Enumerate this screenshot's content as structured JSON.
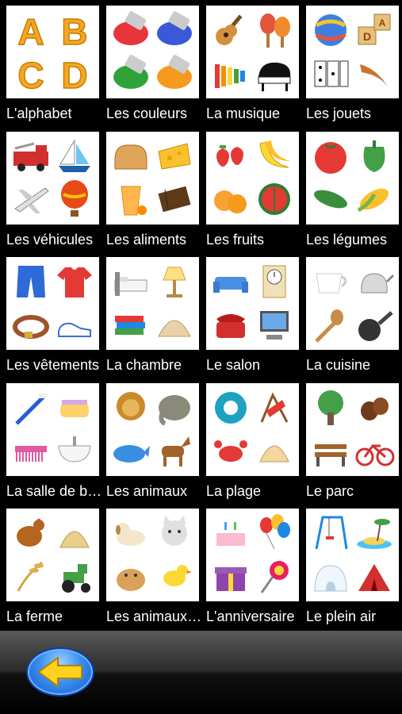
{
  "categories": [
    {
      "label": "L'alphabet",
      "pics": [
        "letter-a",
        "letter-b",
        "letter-c",
        "letter-d"
      ]
    },
    {
      "label": "Les couleurs",
      "pics": [
        "paint-tube-red",
        "paint-tube-blue",
        "paint-tube-green",
        "paint-tube-orange"
      ]
    },
    {
      "label": "La musique",
      "pics": [
        "guitar",
        "maracas",
        "xylophone",
        "piano"
      ]
    },
    {
      "label": "Les jouets",
      "pics": [
        "ball",
        "blocks",
        "dominoes",
        "boomerang"
      ]
    },
    {
      "label": "Les véhicules",
      "pics": [
        "fire-truck",
        "sailboat",
        "airplane",
        "hot-air-balloon"
      ]
    },
    {
      "label": "Les aliments",
      "pics": [
        "bread",
        "cheese",
        "orange-juice",
        "chocolate"
      ]
    },
    {
      "label": "Les fruits",
      "pics": [
        "strawberries",
        "bananas",
        "apricots",
        "watermelon"
      ]
    },
    {
      "label": "Les légumes",
      "pics": [
        "tomato",
        "green-pepper",
        "cucumber",
        "corn"
      ]
    },
    {
      "label": "Les vêtements",
      "pics": [
        "jeans",
        "t-shirt",
        "belt",
        "sneakers"
      ]
    },
    {
      "label": "La chambre",
      "pics": [
        "bed",
        "lamp",
        "books",
        "shell-lamp"
      ]
    },
    {
      "label": "Le salon",
      "pics": [
        "sofa",
        "clock",
        "telephone",
        "computer"
      ]
    },
    {
      "label": "La cuisine",
      "pics": [
        "cup",
        "kettle",
        "wooden-spoon",
        "frying-pan"
      ]
    },
    {
      "label": "La salle de bain",
      "pics": [
        "toothbrush",
        "soap",
        "comb",
        "sink"
      ]
    },
    {
      "label": "Les animaux",
      "pics": [
        "lion",
        "elephant",
        "whale",
        "horse"
      ]
    },
    {
      "label": "La plage",
      "pics": [
        "swim-ring",
        "beach-chair",
        "crab",
        "seashell"
      ]
    },
    {
      "label": "Le parc",
      "pics": [
        "tree",
        "chestnuts",
        "bench",
        "bicycle"
      ]
    },
    {
      "label": "La ferme",
      "pics": [
        "hen",
        "hay",
        "wheat",
        "tractor"
      ]
    },
    {
      "label": "Les animaux domestiques",
      "pics": [
        "dog",
        "cat",
        "hamster",
        "canary"
      ]
    },
    {
      "label": "L'anniversaire",
      "pics": [
        "birthday-cake",
        "balloons",
        "gift",
        "candy"
      ]
    },
    {
      "label": "Le plein air",
      "pics": [
        "swing-set",
        "island",
        "igloo",
        "tent"
      ]
    }
  ],
  "colors": {
    "background": "#000000",
    "tile": "#ffffff",
    "label": "#ffffff",
    "back_button": "#2f7fe8",
    "back_arrow": "#ffd21f"
  },
  "back_button": {
    "icon": "back-arrow-icon"
  }
}
